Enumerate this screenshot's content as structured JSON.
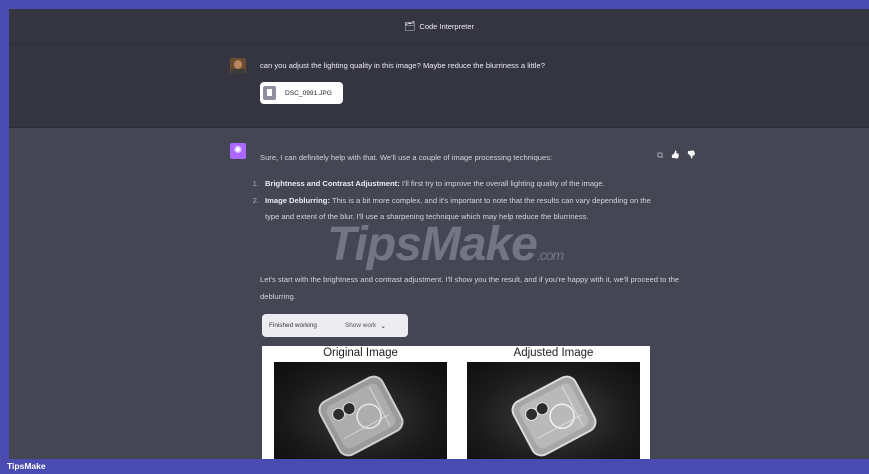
{
  "header": {
    "icon": "code-interpreter-icon",
    "title": "Code Interpreter"
  },
  "user_message": {
    "text": "can you adjust the lighting quality in this image? Maybe reduce the blurriness a little?",
    "attachment": {
      "icon": "file-icon",
      "filename": "DSC_0991.JPG"
    }
  },
  "assistant_message": {
    "intro": "Sure, I can definitely help with that. We'll use a couple of image processing techniques:",
    "actions": [
      {
        "name": "copy-icon",
        "glyph": "⧉"
      },
      {
        "name": "thumbs-up-icon",
        "glyph": "👍"
      },
      {
        "name": "thumbs-down-icon",
        "glyph": "👎"
      }
    ],
    "steps": [
      {
        "num": "1.",
        "title": "Brightness and Contrast Adjustment:",
        "text": " I'll first try to improve the overall lighting quality of the image."
      },
      {
        "num": "2.",
        "title": "Image Deblurring:",
        "text": " This is a bit more complex, and it's important to note that the results can vary depending on the type and extent of the blur. I'll use a sharpening technique which may help reduce the blurriness."
      }
    ],
    "follow_up": "Let's start with the brightness and contrast adjustment. I'll show you the result, and if you're happy with it, we'll proceed to the deblurring.",
    "work": {
      "status": "Finished working",
      "toggle": "Show work",
      "chevron": "⌄"
    },
    "figure": {
      "left_title": "Original Image",
      "right_title": "Adjusted Image"
    }
  },
  "watermark": {
    "main": "TipsMake",
    "suffix": ".com"
  },
  "brand": {
    "label": "TipsMake"
  },
  "colors": {
    "accent": "#ab68ff",
    "frame": "#4a4bb0",
    "user_bg": "#343541",
    "assistant_bg": "#444654"
  }
}
